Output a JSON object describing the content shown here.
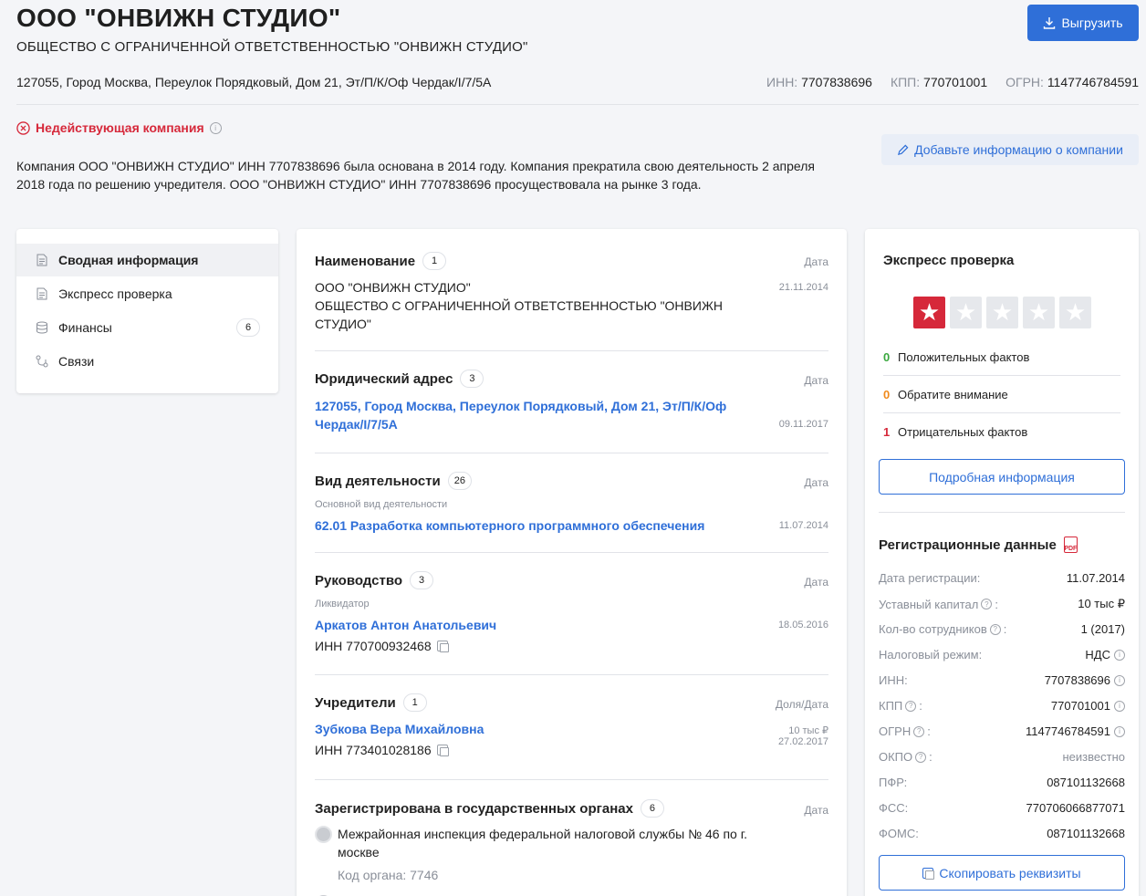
{
  "company": {
    "short_name": "ООО \"ОНВИЖН СТУДИО\"",
    "full_name": "ОБЩЕСТВО С ОГРАНИЧЕННОЙ ОТВЕТСТВЕННОСТЬЮ \"ОНВИЖН СТУДИО\"",
    "address": "127055, Город Москва, Переулок Порядковый, Дом 21, Эт/П/К/Оф Чердак/I/7/5А",
    "inn_label": "ИНН:",
    "inn": "7707838696",
    "kpp_label": "КПП:",
    "kpp": "770701001",
    "ogrn_label": "ОГРН:",
    "ogrn": "1147746784591",
    "status": "Недействующая компания",
    "description": "Компания ООО \"ОНВИЖН СТУДИО\" ИНН 7707838696 была основана в 2014 году. Компания прекратила свою деятельность 2 апреля 2018 года по решению учредителя. ООО \"ОНВИЖН СТУДИО\" ИНН 7707838696 просуществовала на рынке 3 года."
  },
  "header": {
    "export_label": "Выгрузить",
    "add_info_label": "Добавьте информацию о компании"
  },
  "nav": {
    "items": [
      {
        "label": "Сводная информация",
        "icon": "document-icon"
      },
      {
        "label": "Экспресс проверка",
        "icon": "document-icon"
      },
      {
        "label": "Финансы",
        "icon": "database-icon",
        "badge": "6"
      },
      {
        "label": "Связи",
        "icon": "links-icon"
      }
    ]
  },
  "main": {
    "date_label": "Дата",
    "name": {
      "title": "Наименование",
      "badge": "1",
      "line1": "ООО \"ОНВИЖН СТУДИО\"",
      "line2": "ОБЩЕСТВО С ОГРАНИЧЕННОЙ ОТВЕТСТВЕННОСТЬЮ \"ОНВИЖН СТУДИО\"",
      "date": "21.11.2014"
    },
    "legal_address": {
      "title": "Юридический адрес",
      "badge": "3",
      "value": "127055, Город Москва, Переулок Порядковый, Дом 21, Эт/П/К/Оф Чердак/I/7/5А",
      "date": "09.11.2017"
    },
    "activity": {
      "title": "Вид деятельности",
      "badge": "26",
      "sub": "Основной вид деятельности",
      "value": "62.01 Разработка компьютерного программного обеспечения",
      "date": "11.07.2014"
    },
    "management": {
      "title": "Руководство",
      "badge": "3",
      "role": "Ликвидатор",
      "person": "Аркатов Антон Анатольевич",
      "inn": "ИНН 770700932468",
      "date": "18.05.2016"
    },
    "founders": {
      "title": "Учредители",
      "badge": "1",
      "date_label": "Доля/Дата",
      "person": "Зубкова Вера Михайловна",
      "inn": "ИНН 773401028186",
      "share": "10 тыс ₽",
      "date": "27.02.2017"
    },
    "gov": {
      "title": "Зарегистрирована в государственных органах",
      "badge": "6",
      "org": "Межрайонная инспекция федеральной налоговой службы № 46 по г. москве",
      "code": "Код органа: 7746"
    }
  },
  "express": {
    "title": "Экспресс проверка",
    "rating": 1,
    "max_rating": 5,
    "positive": {
      "count": "0",
      "label": "Положительных фактов",
      "color": "#3aa83f"
    },
    "attention": {
      "count": "0",
      "label": "Обратите внимание",
      "color": "#f08a1c"
    },
    "negative": {
      "count": "1",
      "label": "Отрицательных фактов",
      "color": "#d6283a"
    },
    "details_label": "Подробная информация"
  },
  "registration": {
    "title": "Регистрационные данные",
    "rows": [
      {
        "k": "Дата регистрации:",
        "v": "11.07.2014"
      },
      {
        "k": "Уставный капитал",
        "q": true,
        "v": "10 тыс ₽"
      },
      {
        "k": "Кол-во сотрудников",
        "q": true,
        "v": "1 (2017)"
      },
      {
        "k": "Налоговый режим:",
        "v": "НДС",
        "i": true
      },
      {
        "k": "ИНН:",
        "v": "7707838696",
        "i": true
      },
      {
        "k": "КПП",
        "q": true,
        "v": "770701001",
        "i": true
      },
      {
        "k": "ОГРН",
        "q": true,
        "v": "1147746784591",
        "i": true
      },
      {
        "k": "ОКПО",
        "q": true,
        "v": "неизвестно",
        "muted": true
      },
      {
        "k": "ПФР:",
        "v": "087101132668"
      },
      {
        "k": "ФСС:",
        "v": "770706066877071"
      },
      {
        "k": "ФОМС:",
        "v": "087101132668"
      }
    ],
    "copy_label": "Скопировать реквизиты"
  }
}
